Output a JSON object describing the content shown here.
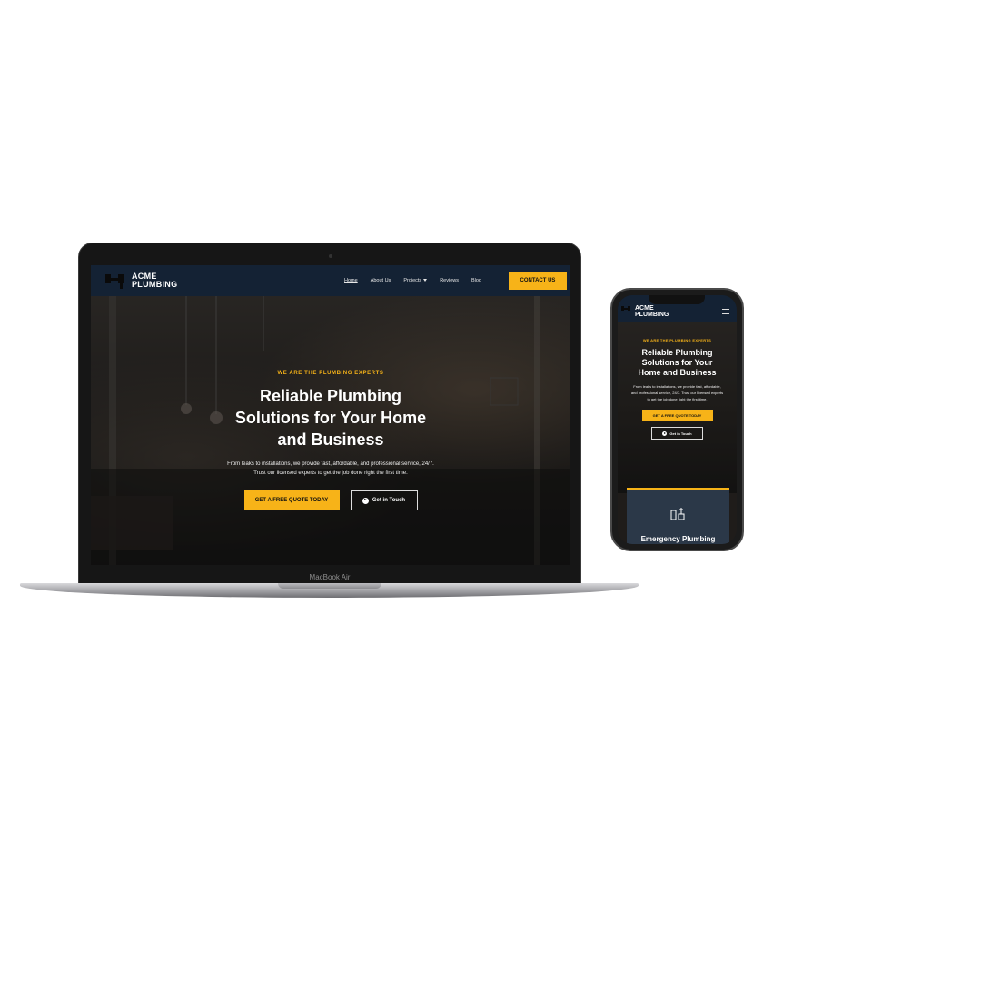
{
  "laptop": {
    "device_label": "MacBook Air"
  },
  "site": {
    "logo_text": "ACME\nPLUMBING",
    "nav": {
      "items": [
        {
          "label": "Home",
          "active": true
        },
        {
          "label": "About Us"
        },
        {
          "label": "Projects",
          "has_dropdown": true
        },
        {
          "label": "Reviews"
        },
        {
          "label": "Blog"
        }
      ],
      "cta": "CONTACT US"
    },
    "hero": {
      "eyebrow": "WE ARE THE PLUMBING EXPERTS",
      "title": "Reliable Plumbing Solutions for Your Home and Business",
      "subtitle": "From leaks to installations, we provide fast, affordable, and professional service, 24/7. Trust our licensed experts to get the job done right the first time.",
      "primary_button": "GET A FREE QUOTE TODAY",
      "secondary_button": "Get in Touch"
    }
  },
  "mobile": {
    "logo_text": "ACME\nPLUMBING",
    "card_title": "Emergency Plumbing"
  },
  "colors": {
    "accent": "#f7b318",
    "nav_bg": "#142234",
    "card_bg": "#2b3848"
  }
}
